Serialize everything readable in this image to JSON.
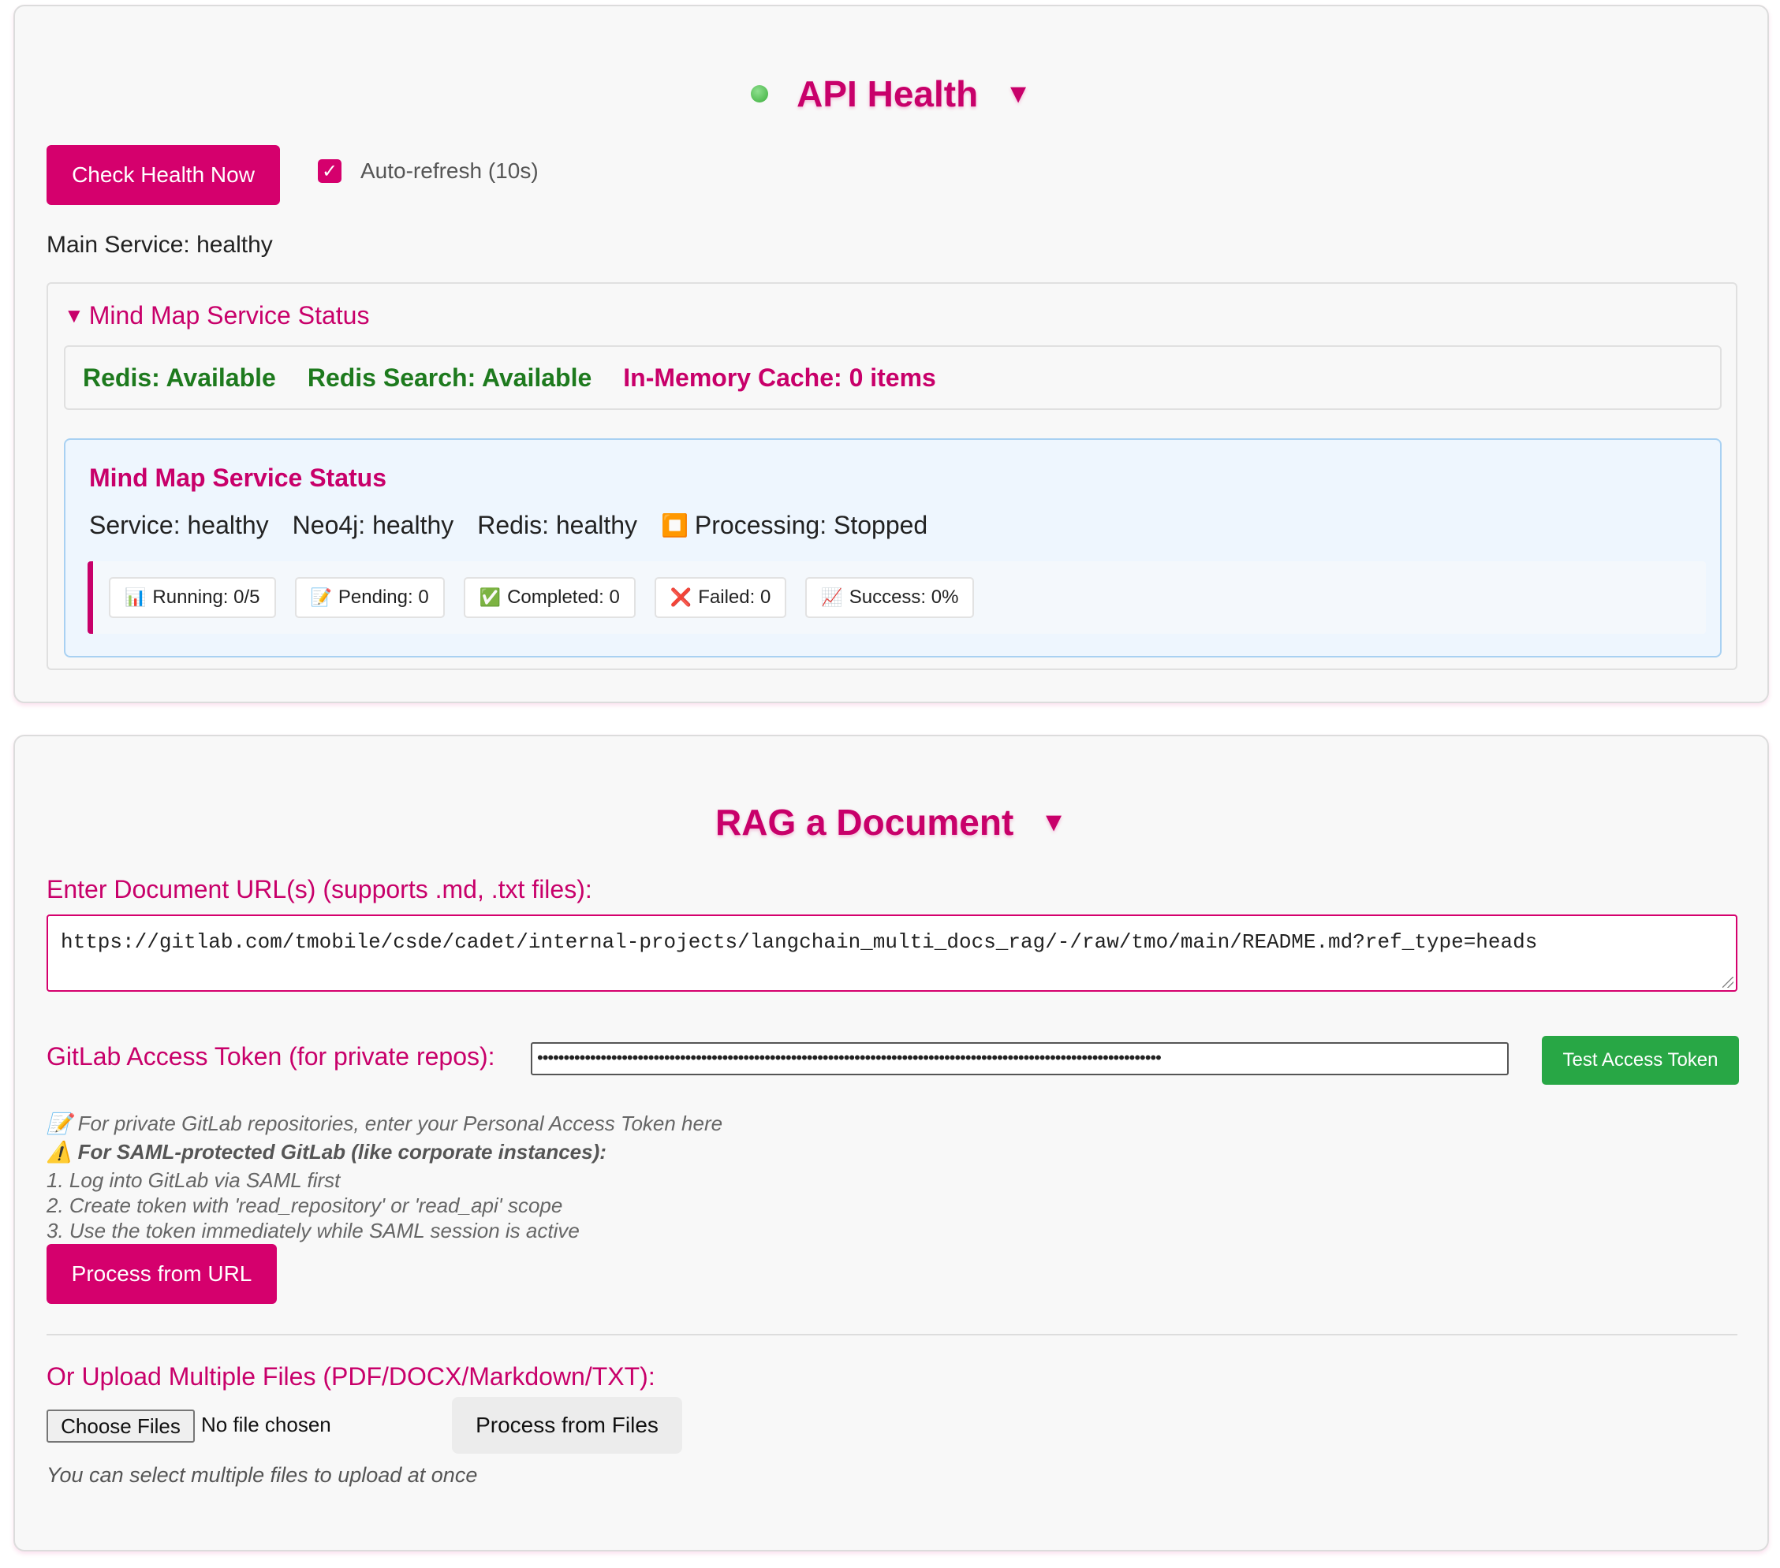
{
  "api_health": {
    "title": "API Health",
    "toggle_caret": "▼",
    "status_dot_color": "#4caf50",
    "check_button": "Check Health Now",
    "auto_refresh_checked": true,
    "auto_refresh_label": "Auto-refresh (10s)",
    "main_service": "Main Service: healthy",
    "mind_map_details": {
      "summary": "Mind Map Service Status",
      "redis": "Redis: Available",
      "redis_search": "Redis Search: Available",
      "memory_cache": "In-Memory Cache: 0 items",
      "box": {
        "title": "Mind Map Service Status",
        "service": "Service: healthy",
        "neo4j": "Neo4j: healthy",
        "redis": "Redis: healthy",
        "processing_icon": "⏹️",
        "processing": "Processing: Stopped",
        "stats": [
          {
            "icon": "📊",
            "text": "Running: 0/5"
          },
          {
            "icon": "📝",
            "text": "Pending: 0"
          },
          {
            "icon": "✅",
            "text": "Completed: 0"
          },
          {
            "icon": "❌",
            "text": "Failed: 0"
          },
          {
            "icon": "📈",
            "text": "Success: 0%"
          }
        ]
      }
    }
  },
  "rag": {
    "title": "RAG a Document",
    "toggle_caret": "▼",
    "url_label": "Enter Document URL(s) (supports .md, .txt files):",
    "url_value": "https://gitlab.com/tmobile/csde/cadet/internal-projects/langchain_multi_docs_rag/-/raw/tmo/main/README.md?ref_type=heads",
    "token_label": "GitLab Access Token (for private repos):",
    "token_value": "••••••••••••••••••••••••••••••••••••••••••••••••••••••••••••••••••••••••••••••••••••••••••••••••••••••••••••••••••••••",
    "test_token_button": "Test Access Token",
    "help": {
      "line1_icon": "📝",
      "line1": "For private GitLab repositories, enter your Personal Access Token here",
      "line2_icon": "⚠️",
      "line2": "For SAML-protected GitLab (like corporate instances):",
      "line3": "1. Log into GitLab via SAML first",
      "line4": "2. Create token with 'read_repository' or 'read_api' scope",
      "line5": "3. Use the token immediately while SAML session is active"
    },
    "process_url_button": "Process from URL",
    "upload_label": "Or Upload Multiple Files (PDF/DOCX/Markdown/TXT):",
    "choose_files_button": "Choose Files",
    "no_file_text": "No file chosen",
    "process_files_button": "Process from Files",
    "upload_hint": "You can select multiple files to upload at once"
  }
}
